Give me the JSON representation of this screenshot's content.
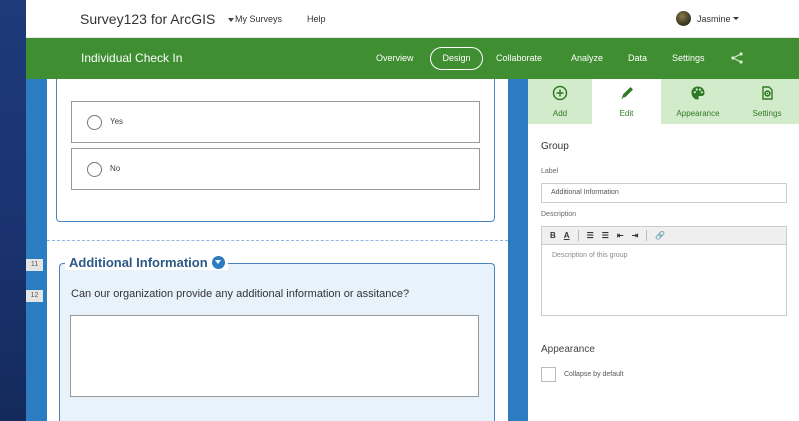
{
  "topbar": {
    "app_title": "Survey123 for ArcGIS",
    "nav": [
      "My Surveys",
      "Help"
    ],
    "user_name": "Jasmine"
  },
  "survey": {
    "name": "Individual Check In",
    "tabs": [
      "Overview",
      "Design",
      "Collaborate",
      "Analyze",
      "Data",
      "Settings"
    ],
    "active_tab": "Design"
  },
  "canvas": {
    "options": [
      "Yes",
      "No"
    ],
    "row_numbers": [
      "11",
      "12"
    ],
    "group_title": "Additional Information",
    "question": "Can our organization provide any additional information or assitance?"
  },
  "panel": {
    "tabs": [
      {
        "label": "Add",
        "icon": "add-circle-icon"
      },
      {
        "label": "Edit",
        "icon": "pencil-icon"
      },
      {
        "label": "Appearance",
        "icon": "palette-icon"
      },
      {
        "label": "Settings",
        "icon": "settings-icon"
      }
    ],
    "active_tab": "Edit",
    "heading": "Group",
    "label_caption": "Label",
    "label_value": "Additional Information",
    "description_caption": "Description",
    "description_placeholder": "Description of this group",
    "appearance_heading": "Appearance",
    "collapse_label": "Collapse by default",
    "collapse_checked": false
  },
  "colors": {
    "green": "#3f8e31",
    "blue": "#2b7cc1",
    "tab_inactive": "#d2ebca",
    "group_bg": "#e8f2fa"
  }
}
